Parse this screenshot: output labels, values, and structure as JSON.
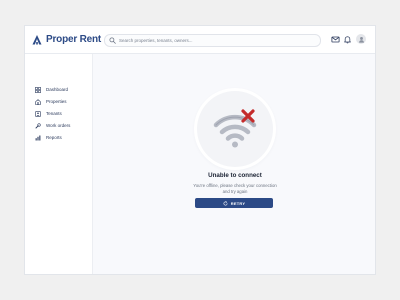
{
  "app": {
    "brand_name": "Proper Rent",
    "brand_color": "#2c4a86"
  },
  "topbar": {
    "search_placeholder": "Search properties, tenants, owners...",
    "icons": [
      "mail-icon",
      "bell-icon",
      "avatar-icon"
    ]
  },
  "sidebar": {
    "items": [
      {
        "label": "Dashboard",
        "icon": "dashboard-icon"
      },
      {
        "label": "Properties",
        "icon": "home-icon"
      },
      {
        "label": "Tenants",
        "icon": "tenants-icon"
      },
      {
        "label": "Work orders",
        "icon": "wrench-icon"
      },
      {
        "label": "Reports",
        "icon": "bar-chart-icon"
      }
    ]
  },
  "empty_state": {
    "icon": "wifi-off-icon",
    "title": "Unable to connect",
    "message": "You're offline, please check your connection and try again",
    "button_label": "RETRY",
    "button_icon": "refresh-icon",
    "accent_color": "#2c4a86",
    "error_color": "#c42b2b"
  }
}
